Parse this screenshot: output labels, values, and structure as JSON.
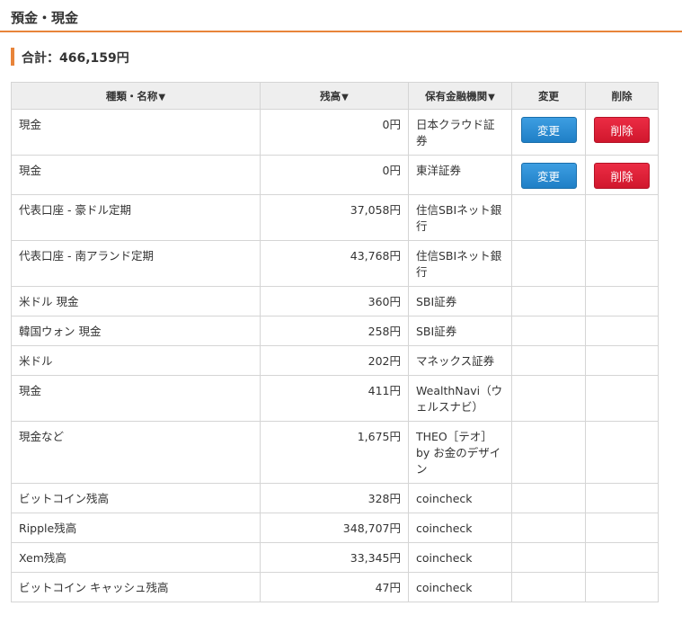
{
  "header": {
    "title": "預金・現金"
  },
  "summary": {
    "total_label": "合計：466,159円"
  },
  "table": {
    "columns": [
      {
        "label": "種類・名称",
        "sort_icon": "▼"
      },
      {
        "label": "残高",
        "sort_icon": "▼"
      },
      {
        "label": "保有金融機関",
        "sort_icon": "▼"
      },
      {
        "label": "変更",
        "sort_icon": ""
      },
      {
        "label": "削除",
        "sort_icon": ""
      }
    ],
    "rows": [
      {
        "name": "現金",
        "amount": "0円",
        "institution": "日本クラウド証券",
        "edit_label": "変更",
        "delete_label": "削除"
      },
      {
        "name": "現金",
        "amount": "0円",
        "institution": "東洋証券",
        "edit_label": "変更",
        "delete_label": "削除"
      },
      {
        "name": "代表口座 - 豪ドル定期",
        "amount": "37,058円",
        "institution": "住信SBIネット銀行",
        "edit_label": "",
        "delete_label": ""
      },
      {
        "name": "代表口座 - 南アランド定期",
        "amount": "43,768円",
        "institution": "住信SBIネット銀行",
        "edit_label": "",
        "delete_label": ""
      },
      {
        "name": "米ドル 現金",
        "amount": "360円",
        "institution": "SBI証券",
        "edit_label": "",
        "delete_label": ""
      },
      {
        "name": "韓国ウォン 現金",
        "amount": "258円",
        "institution": "SBI証券",
        "edit_label": "",
        "delete_label": ""
      },
      {
        "name": "米ドル",
        "amount": "202円",
        "institution": "マネックス証券",
        "edit_label": "",
        "delete_label": ""
      },
      {
        "name": "現金",
        "amount": "411円",
        "institution": "WealthNavi（ウェルスナビ）",
        "edit_label": "",
        "delete_label": ""
      },
      {
        "name": "現金など",
        "amount": "1,675円",
        "institution": "THEO［テオ］by お金のデザイン",
        "edit_label": "",
        "delete_label": ""
      },
      {
        "name": "ビットコイン残高",
        "amount": "328円",
        "institution": "coincheck",
        "edit_label": "",
        "delete_label": ""
      },
      {
        "name": "Ripple残高",
        "amount": "348,707円",
        "institution": "coincheck",
        "edit_label": "",
        "delete_label": ""
      },
      {
        "name": "Xem残高",
        "amount": "33,345円",
        "institution": "coincheck",
        "edit_label": "",
        "delete_label": ""
      },
      {
        "name": "ビットコイン キャッシュ残高",
        "amount": "47円",
        "institution": "coincheck",
        "edit_label": "",
        "delete_label": ""
      }
    ]
  },
  "colors": {
    "accent_orange": "#e8843a",
    "edit_button": "#2a8bd4",
    "delete_button": "#e0223a",
    "header_bg": "#eeeeee"
  }
}
